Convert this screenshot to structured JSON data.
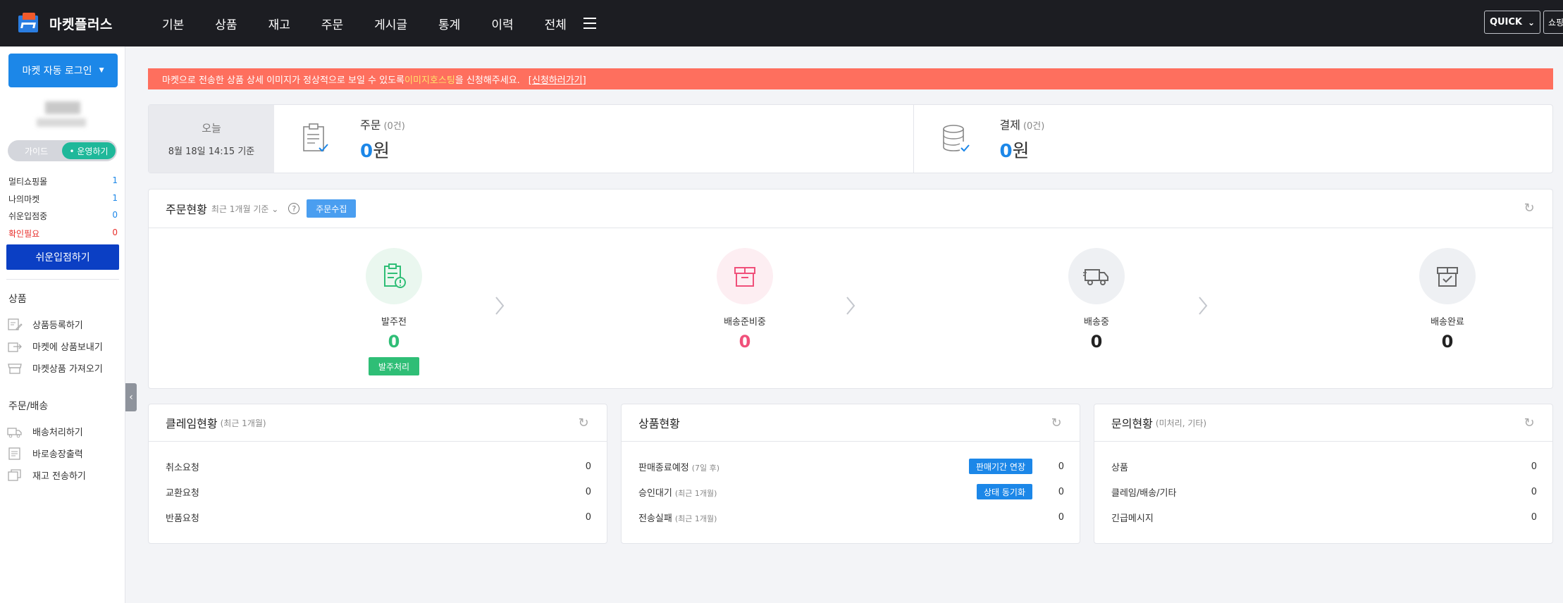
{
  "header": {
    "logo_text": "마켓플러스",
    "menu": [
      "기본",
      "상품",
      "재고",
      "주문",
      "게시글",
      "통계",
      "이력",
      "전체"
    ],
    "quick_label": "QUICK",
    "shop_label": "쇼핑"
  },
  "sidebar": {
    "auto_login_label": "마켓 자동 로그인",
    "toggle": {
      "guide": "가이드",
      "run": "• 운영하기"
    },
    "stats": [
      {
        "label": "멀티쇼핑몰",
        "value": "1"
      },
      {
        "label": "나의마켓",
        "value": "1"
      },
      {
        "label": "쉬운입점중",
        "value": "0"
      },
      {
        "label": "확인필요",
        "value": "0"
      }
    ],
    "easy_button": "쉬운입점하기",
    "sections": [
      {
        "title": "상품",
        "items": [
          "상품등록하기",
          "마켓에 상품보내기",
          "마켓상품 가져오기"
        ]
      },
      {
        "title": "주문/배송",
        "items": [
          "배송처리하기",
          "바로송장출력",
          "재고 전송하기"
        ]
      }
    ]
  },
  "banner": {
    "text_before": "마켓으로 전송한 상품 상세 이미지가 정상적으로 보일 수 있도록 ",
    "highlight": "이미지호스팅",
    "text_after": "을 신청해주세요.",
    "link": "[신청하러가기]"
  },
  "today": {
    "label": "오늘",
    "timestamp": "8월 18일 14:15 기준",
    "order": {
      "label": "주문",
      "count": "(0건)",
      "amount": "0",
      "unit": "원"
    },
    "payment": {
      "label": "결제",
      "count": "(0건)",
      "amount": "0",
      "unit": "원"
    }
  },
  "order_status": {
    "title": "주문현황",
    "period": "최근 1개월 기준",
    "help": "?",
    "collect_button": "주문수집",
    "steps": [
      {
        "name": "발주전",
        "count": "0",
        "color": "#2fbe76",
        "action": "발주처리"
      },
      {
        "name": "배송준비중",
        "count": "0",
        "color": "#f0507a"
      },
      {
        "name": "배송중",
        "count": "0",
        "color": "#222222"
      },
      {
        "name": "배송완료",
        "count": "0",
        "color": "#222222"
      }
    ]
  },
  "claims": {
    "title": "클레임현황",
    "sub": "(최근 1개월)",
    "rows": [
      {
        "label": "취소요청",
        "value": "0"
      },
      {
        "label": "교환요청",
        "value": "0"
      },
      {
        "label": "반품요청",
        "value": "0"
      }
    ]
  },
  "products": {
    "title": "상품현황",
    "rows": [
      {
        "label": "판매종료예정",
        "sub": "(7일 후)",
        "badge": "판매기간 연장",
        "value": "0"
      },
      {
        "label": "승인대기",
        "sub": "(최근 1개월)",
        "badge": "상태 동기화",
        "value": "0"
      },
      {
        "label": "전송실패",
        "sub": "(최근 1개월)",
        "value": "0"
      }
    ]
  },
  "inquiries": {
    "title": "문의현황",
    "sub": "(미처리, 기타)",
    "rows": [
      {
        "label": "상품",
        "value": "0"
      },
      {
        "label": "클레임/배송/기타",
        "value": "0"
      },
      {
        "label": "긴급메시지",
        "value": "0"
      }
    ]
  }
}
